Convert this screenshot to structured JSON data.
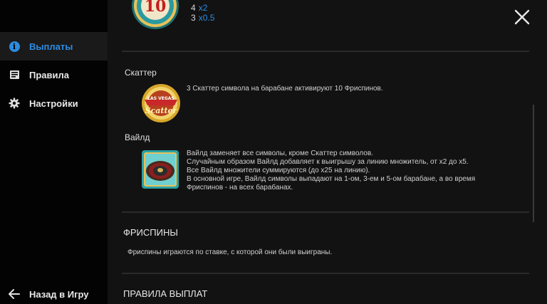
{
  "sidebar": {
    "items": [
      {
        "label": "Выплаты",
        "icon": "info-icon"
      },
      {
        "label": "Правила",
        "icon": "book-icon"
      },
      {
        "label": "Настройки",
        "icon": "gear-icon"
      }
    ],
    "back": {
      "label": "Назад в Игру",
      "icon": "arrow-left-icon"
    }
  },
  "paytable": {
    "top_symbol_value": "10",
    "rows": [
      {
        "count": "4",
        "mult": "x2"
      },
      {
        "count": "3",
        "mult": "x0.5"
      }
    ]
  },
  "scatter": {
    "title": "Скаттер",
    "symbol_text": [
      "LAS VEGAS",
      "Scatter"
    ],
    "text": "3 Скаттер символа на барабане активируют 10 Фриспинов."
  },
  "wild": {
    "title": "Вайлд",
    "lines": [
      "Вайлд заменяет все символы, кроме Скаттер символов.",
      "Случайным образом Вайлд добавляет к выигрышу за линию множитель, от x2 до x5.",
      "Все Вайлд множители суммируются (до x25 на линию).",
      "В основной игре, Вайлд символы выпадают на 1-ом, 3-ем и 5-ом барабане, а во время",
      "Фриспинов - на всех барабанах."
    ]
  },
  "freespins": {
    "title": "ФРИСПИНЫ",
    "text": "Фриспины играются по ставке, с которой они были выиграны."
  },
  "payout_rules": {
    "title": "ПРАВИЛА ВЫПЛАТ"
  },
  "colors": {
    "accent": "#2d8be0",
    "sidebar": "#030303",
    "content": "#121212"
  }
}
